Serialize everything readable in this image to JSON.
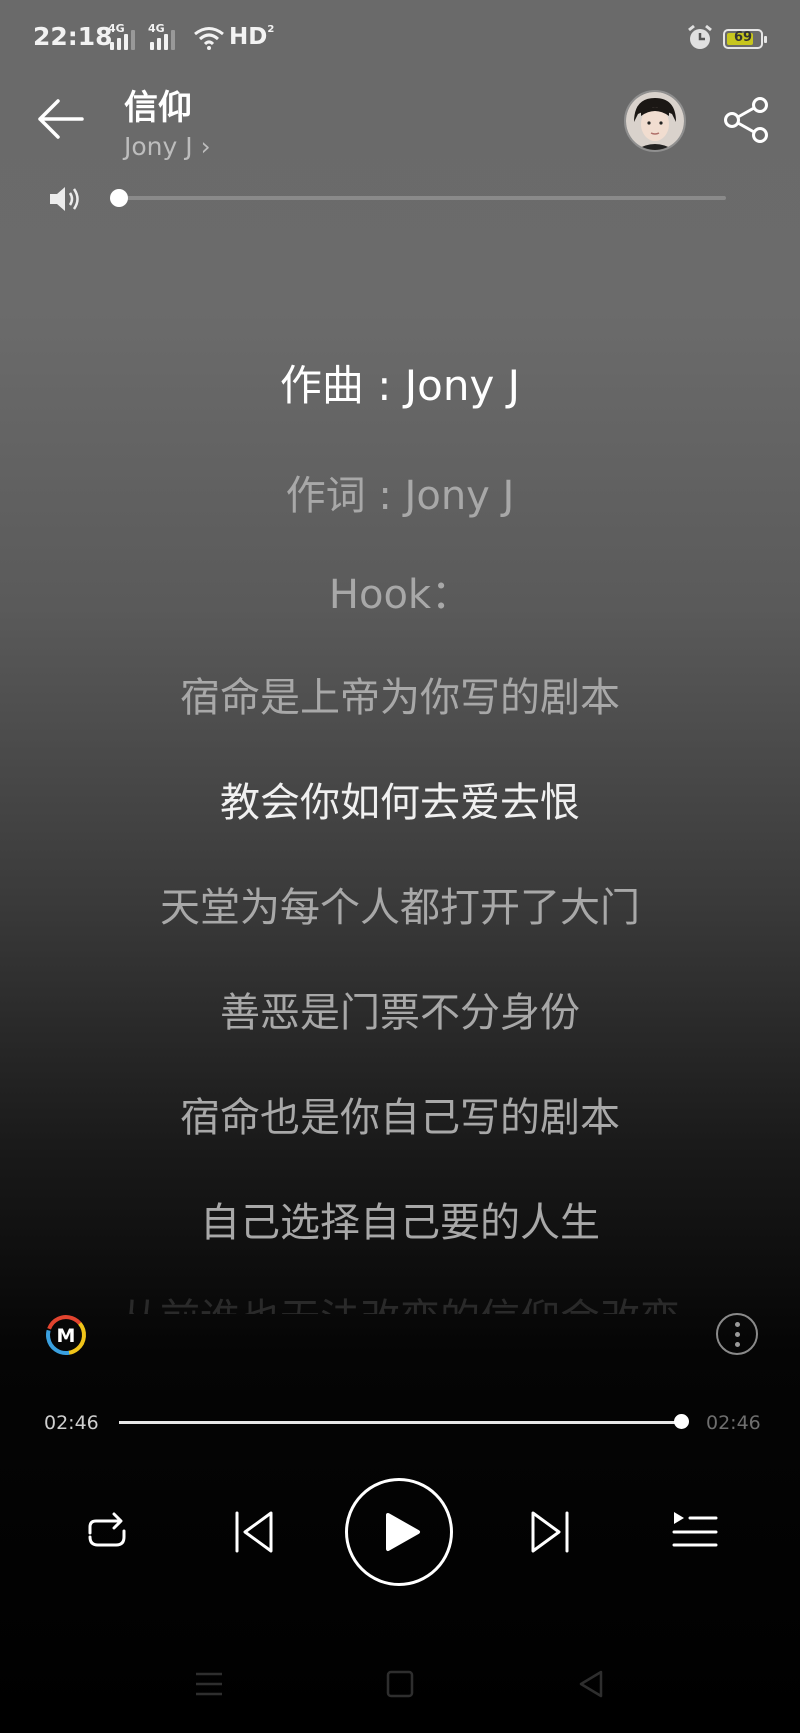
{
  "status_bar": {
    "time": "22:18",
    "network1": "4G",
    "network2": "4G",
    "hd": "HD",
    "hd_sub": "2",
    "battery": "69",
    "icons": [
      "signal-icon",
      "wifi-icon",
      "alarm-icon",
      "battery-icon"
    ]
  },
  "header": {
    "title": "信仰",
    "artist": "Jony J",
    "artist_chevron": "›"
  },
  "lyrics": [
    {
      "text": "作曲 : Jony J",
      "state": "active"
    },
    {
      "text": "作词 : Jony J",
      "state": "normal"
    },
    {
      "text": "Hook：",
      "state": "normal"
    },
    {
      "text": "宿命是上帝为你写的剧本",
      "state": "normal"
    },
    {
      "text": "教会你如何去爱去恨",
      "state": "bright"
    },
    {
      "text": "天堂为每个人都打开了大门",
      "state": "normal"
    },
    {
      "text": "善恶是门票不分身份",
      "state": "normal"
    },
    {
      "text": "宿命也是你自己写的剧本",
      "state": "normal"
    },
    {
      "text": "自己选择自己要的人生",
      "state": "normal"
    },
    {
      "text": "从前谁也无法改变的信仰会改变",
      "state": "fade"
    }
  ],
  "player": {
    "logo_letter": "M",
    "current_time": "02:46",
    "total_time": "02:46",
    "progress_fraction": 1.0,
    "volume_fraction": 0.0
  },
  "colors": {
    "accent_red": "#e2442f",
    "accent_yellow": "#f0c419",
    "accent_blue": "#3aa0e0"
  }
}
